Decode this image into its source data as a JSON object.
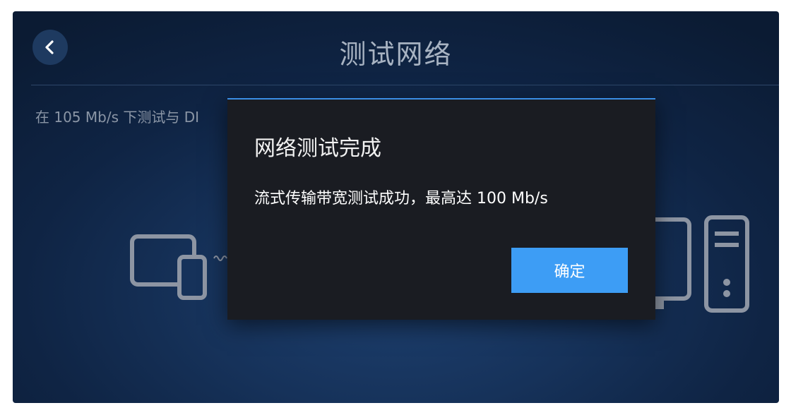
{
  "header": {
    "title": "测试网络",
    "back_icon": "chevron-left-icon"
  },
  "info": {
    "text": "在 105 Mb/s 下测试与 DI"
  },
  "icons": {
    "left_devices": "tablet-and-phone-icon",
    "connection": "wave-connection-icon",
    "right_monitor": "monitor-icon",
    "right_tower": "pc-tower-icon"
  },
  "dialog": {
    "title": "网络测试完成",
    "message": "流式传输带宽测试成功，最高达 100 Mb/s",
    "confirm_label": "确定"
  },
  "colors": {
    "accent": "#3d9df5",
    "dialog_bg": "#1a1c22",
    "background": "#0f2444"
  }
}
